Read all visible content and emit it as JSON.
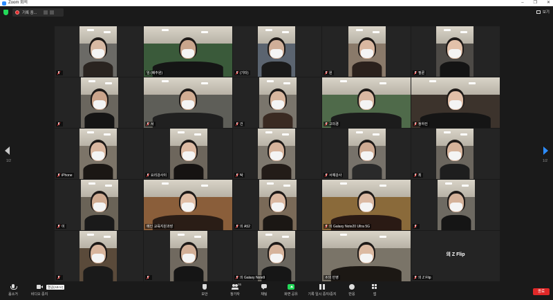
{
  "window": {
    "title": "Zoom 회의",
    "controls": [
      "–",
      "❐",
      "✕"
    ]
  },
  "topbar": {
    "security_color": "#23d959",
    "recording_label": "기록 중...",
    "view_label": "보기"
  },
  "pagination": {
    "left": "1/2",
    "right": "1/2"
  },
  "participants": [
    {
      "name": "",
      "muted": true
    },
    {
      "name": "임       (배추원)",
      "muted": false
    },
    {
      "name": "(기타)",
      "muted": true
    },
    {
      "name": "원",
      "muted": true
    },
    {
      "name": "필룬",
      "muted": true
    },
    {
      "name": "",
      "muted": true
    },
    {
      "name": "서",
      "muted": true
    },
    {
      "name": "건",
      "muted": true
    },
    {
      "name": "고미경",
      "muted": true
    },
    {
      "name": "정하진",
      "muted": true
    },
    {
      "name": "iPhone",
      "muted": true
    },
    {
      "name": "요리강사이",
      "muted": true
    },
    {
      "name": "탁",
      "muted": true
    },
    {
      "name": "서예강사",
      "muted": true
    },
    {
      "name": "최",
      "muted": true
    },
    {
      "name": "이",
      "muted": true
    },
    {
      "name": "메인 교육지원과장",
      "muted": false
    },
    {
      "name": "의 A52",
      "muted": true
    },
    {
      "name": "의 Galaxy Note20 Ultra 5G",
      "muted": true
    },
    {
      "name": "",
      "muted": true
    },
    {
      "name": "",
      "muted": true
    },
    {
      "name": "",
      "muted": true
    },
    {
      "name": "의 Galaxy Note9",
      "muted": true
    },
    {
      "name": "ㅎ의 민영",
      "muted": false
    },
    {
      "name": "의 Z Flip",
      "muted": true,
      "camera_off": true,
      "display_name": "의 Z Flip"
    }
  ],
  "toolbar": {
    "mute": "음소거",
    "video": "비디오 중지",
    "video_tooltip": "열공(Alt+V)",
    "security": "보안",
    "participants": "참가자",
    "participants_count": "26",
    "chat": "채팅",
    "share": "화면 공유",
    "recording": "기록 일시 중지/중지",
    "reactions": "반응",
    "apps": "앱",
    "end": "종료"
  }
}
